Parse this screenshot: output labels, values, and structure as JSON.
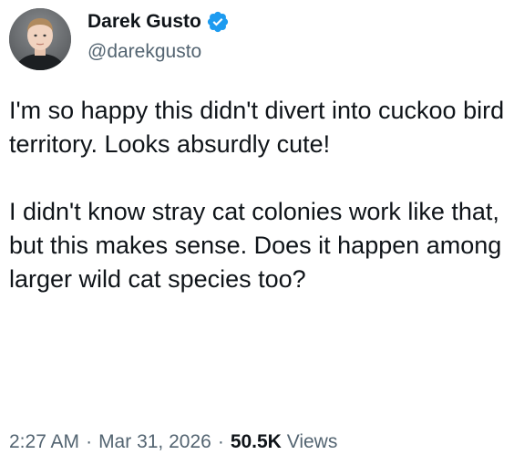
{
  "author": {
    "display_name": "Darek Gusto",
    "handle": "@darekgusto",
    "verified": true
  },
  "tweet": {
    "paragraphs": [
      "I'm so happy this didn't divert into cuckoo bird territory. Looks absurdly cute!",
      "I didn't know stray cat colonies work like that, but this makes sense. Does it happen among larger wild cat species too?"
    ],
    "time": "2:27 AM",
    "date": "Mar 31, 2026",
    "separator": "·",
    "views_count": "50.5K",
    "views_label": "Views"
  },
  "colors": {
    "verified_badge": "#1d9bf0",
    "secondary_text": "#536471",
    "primary_text": "#0f1419"
  }
}
